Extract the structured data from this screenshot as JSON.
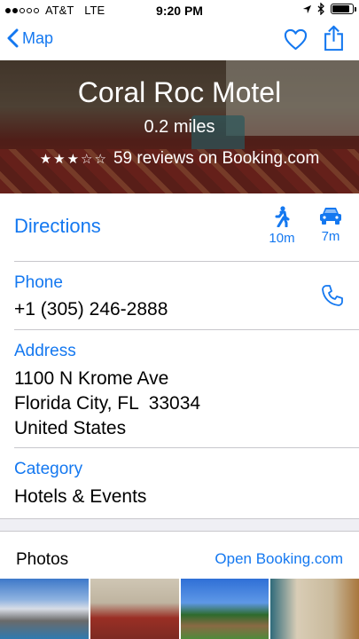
{
  "status_bar": {
    "carrier": "AT&T",
    "network": "LTE",
    "time": "9:20 PM",
    "signal_bars_filled": 2,
    "signal_bars_total": 5,
    "battery_level": 0.85
  },
  "nav": {
    "back_label": "Map",
    "favorite_icon": "heart-icon",
    "share_icon": "share-icon"
  },
  "hero": {
    "title": "Coral Roc Motel",
    "distance": "0.2 miles",
    "stars": "★★★☆☆",
    "stars_value": 3,
    "reviews": "59 reviews on Booking.com"
  },
  "directions": {
    "label": "Directions",
    "walk_time": "10m",
    "drive_time": "7m"
  },
  "phone": {
    "label": "Phone",
    "value": "+1 (305) 246-2888"
  },
  "address": {
    "label": "Address",
    "line1": "1100 N Krome Ave",
    "line2": "Florida City, FL  33034",
    "line3": "United States"
  },
  "category": {
    "label": "Category",
    "value": "Hotels & Events"
  },
  "photos": {
    "title": "Photos",
    "open_link": "Open Booking.com"
  },
  "colors": {
    "accent": "#1478f0",
    "separator": "#c8c7cc",
    "band": "#efeff4"
  }
}
